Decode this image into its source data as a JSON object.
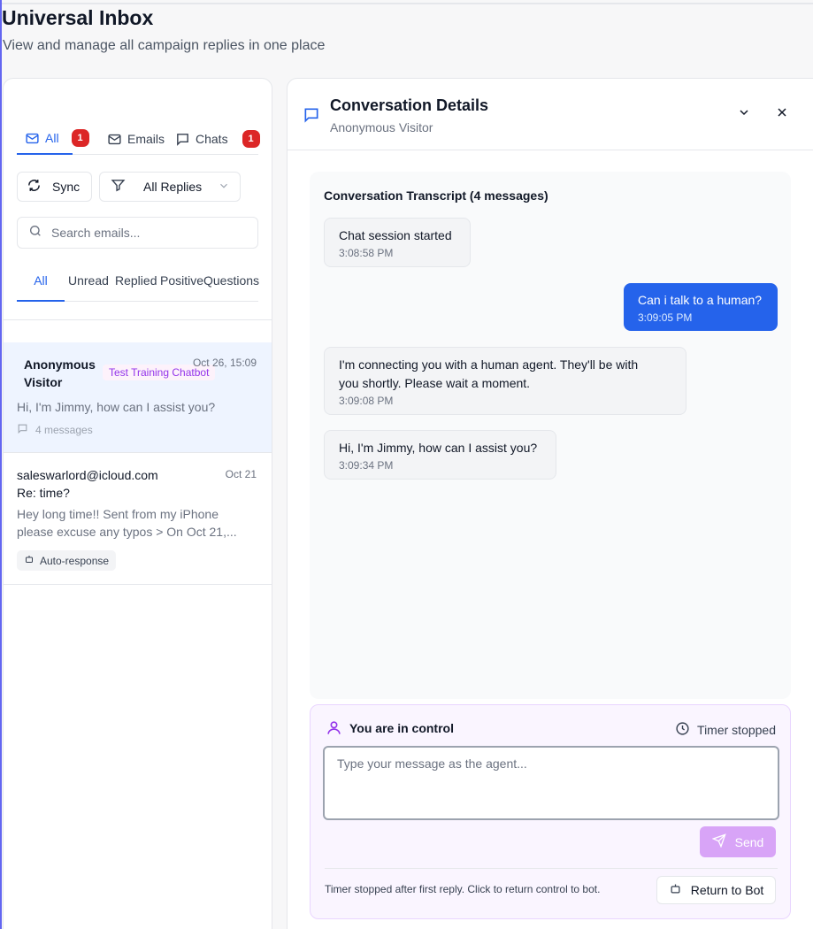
{
  "page": {
    "title": "Universal Inbox",
    "subtitle": "View and manage all campaign replies in one place"
  },
  "tabs": [
    {
      "label": "All",
      "badge": "1",
      "icon": "mail-icon"
    },
    {
      "label": "Emails",
      "icon": "mail-icon"
    },
    {
      "label": "Chats",
      "badge": "1",
      "icon": "chat-icon"
    }
  ],
  "toolbar": {
    "sync_label": "Sync",
    "filter_label": "All Replies"
  },
  "search": {
    "placeholder": "Search emails..."
  },
  "filters": [
    "All",
    "Unread",
    "Replied",
    "Positive",
    "Questions"
  ],
  "conversations": [
    {
      "name_line1": "Anonymous",
      "name_line2": "Visitor",
      "date": "Oct 26, 15:09",
      "tag": "Test Training Chatbot",
      "preview": "Hi, I'm Jimmy, how can I assist you?",
      "meta": "4 messages"
    },
    {
      "name": "saleswarlord@icloud.com",
      "date": "Oct 21",
      "subject": "Re: time?",
      "preview_line1": "Hey long time!! Sent from my iPhone",
      "preview_line2": "please excuse any typos > On Oct 21,...",
      "tag": "Auto-response"
    }
  ],
  "details": {
    "title": "Conversation Details",
    "subtitle": "Anonymous Visitor",
    "transcript_title": "Conversation Transcript (4 messages)",
    "messages": [
      {
        "sender": "bot",
        "text": "Chat session started",
        "time": "3:08:58 PM"
      },
      {
        "sender": "user",
        "text": "Can i talk to a human?",
        "time": "3:09:05 PM"
      },
      {
        "sender": "bot",
        "text_line1": "I'm connecting you with a human agent. They'll be with",
        "text_line2": "you shortly. Please wait a moment.",
        "time": "3:09:08 PM"
      },
      {
        "sender": "bot",
        "text": "Hi, I'm Jimmy, how can I assist you?",
        "time": "3:09:34 PM"
      }
    ]
  },
  "control": {
    "status": "You are in control",
    "timer": "Timer stopped",
    "input_placeholder": "Type your message as the agent...",
    "send_label": "Send",
    "note": "Timer stopped after first reply. Click to return control to bot.",
    "return_label": "Return to Bot"
  },
  "colors": {
    "accent": "#2563eb",
    "badge": "#dc2626",
    "control_bg": "#faf5ff",
    "send_button": "#d8a4f7",
    "tag_purple": "#9333ea"
  }
}
